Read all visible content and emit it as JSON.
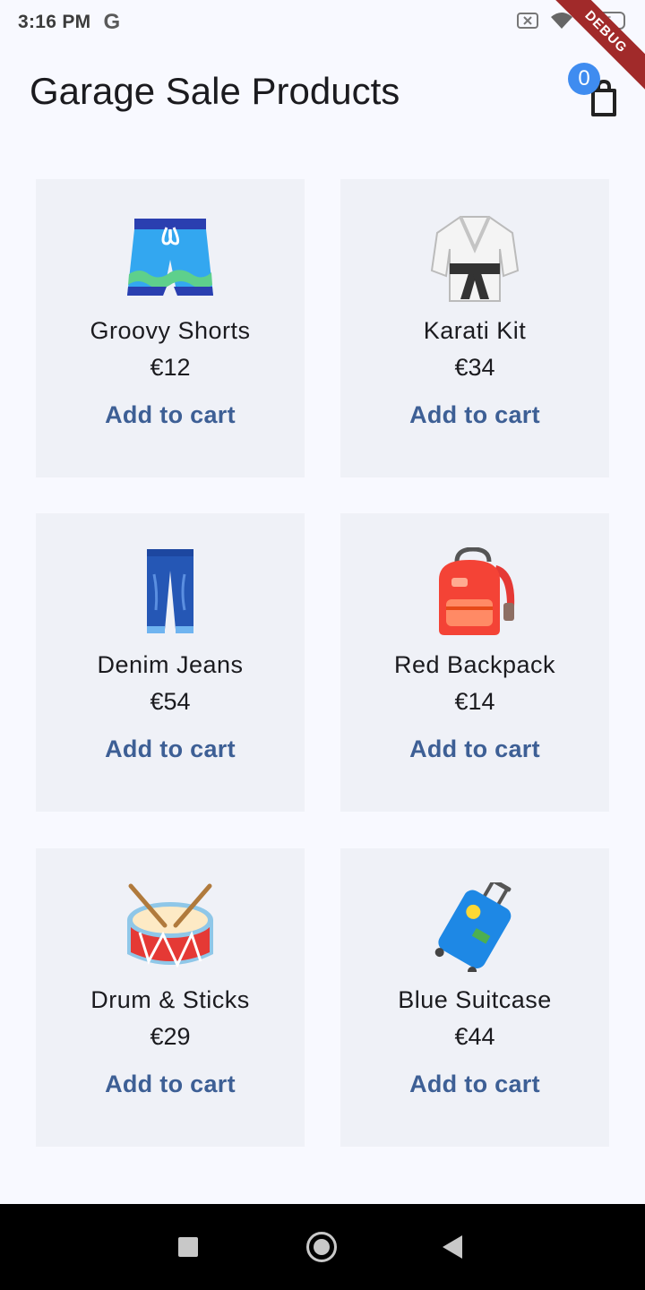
{
  "status_bar": {
    "time": "3:16 PM",
    "google_glyph": "G",
    "battery": "55",
    "debug_label": "DEBUG"
  },
  "app_bar": {
    "title": "Garage Sale Products",
    "cart_count": "0"
  },
  "products": [
    {
      "name": "Groovy Shorts",
      "price": "€12",
      "action": "Add to cart",
      "icon": "shorts-icon"
    },
    {
      "name": "Karati Kit",
      "price": "€34",
      "action": "Add to cart",
      "icon": "martial-arts-uniform-icon"
    },
    {
      "name": "Denim Jeans",
      "price": "€54",
      "action": "Add to cart",
      "icon": "jeans-icon"
    },
    {
      "name": "Red Backpack",
      "price": "€14",
      "action": "Add to cart",
      "icon": "backpack-icon"
    },
    {
      "name": "Drum & Sticks",
      "price": "€29",
      "action": "Add to cart",
      "icon": "drum-icon"
    },
    {
      "name": "Blue Suitcase",
      "price": "€44",
      "action": "Add to cart",
      "icon": "suitcase-icon"
    }
  ],
  "colors": {
    "background": "#f8f9ff",
    "card": "#eff1f7",
    "action": "#3d5f95",
    "badge": "#3f8cf0",
    "debug": "#a12a2a"
  }
}
